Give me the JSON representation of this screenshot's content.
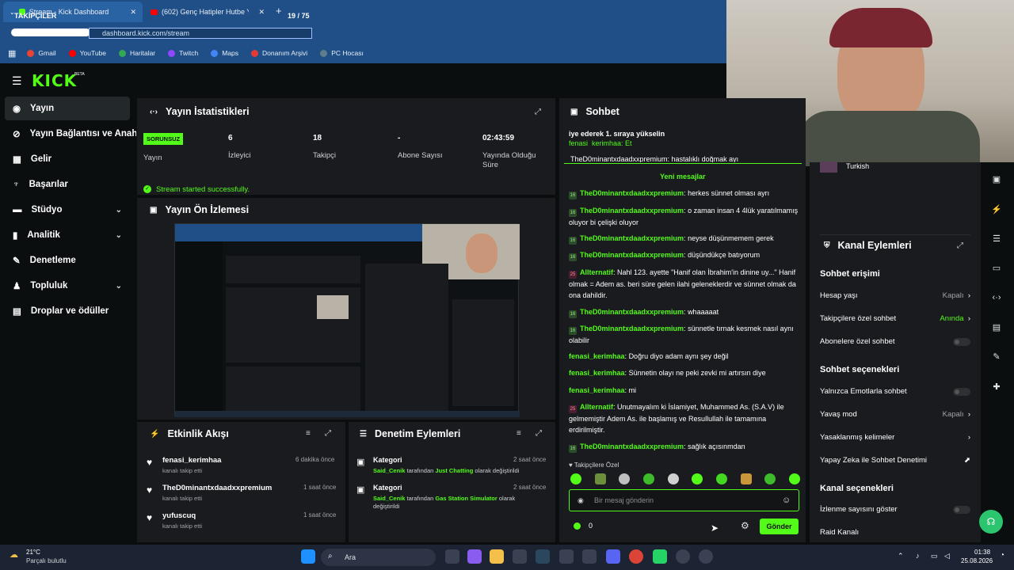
{
  "browser": {
    "tabs": [
      {
        "label": "Stream - Kick Dashboard"
      },
      {
        "label": "(602) Genç Hatipler Hutbe Yarış"
      }
    ],
    "overlay_label": "TAKİPÇİLER",
    "overlay_count": "19 / 75",
    "url": "dashboard.kick.com/stream",
    "new_tab": "+"
  },
  "bookmarks": [
    {
      "label": "Gmail",
      "color": "#ea4335"
    },
    {
      "label": "YouTube",
      "color": "#ff0000"
    },
    {
      "label": "Haritalar",
      "color": "#34a853"
    },
    {
      "label": "Twitch",
      "color": "#9146ff"
    },
    {
      "label": "Maps",
      "color": "#4285f4"
    },
    {
      "label": "Donanım Arşivi",
      "color": "#e53935"
    },
    {
      "label": "PC Hocası",
      "color": "#607d8b"
    }
  ],
  "brand": {
    "logo": "KICK",
    "beta": "BETA"
  },
  "sidebar": {
    "items": [
      {
        "label": "Yayın",
        "icon": "broadcast-icon"
      },
      {
        "label": "Yayın Bağlantısı ve Anahtar",
        "icon": "link-icon"
      },
      {
        "label": "Gelir",
        "icon": "revenue-icon"
      },
      {
        "label": "Başarılar",
        "icon": "trophy-icon"
      },
      {
        "label": "Stüdyo",
        "icon": "studio-icon"
      },
      {
        "label": "Analitik",
        "icon": "analytics-icon"
      },
      {
        "label": "Denetleme",
        "icon": "wrench-icon"
      },
      {
        "label": "Topluluk",
        "icon": "community-icon"
      },
      {
        "label": "Droplar ve ödüller",
        "icon": "drops-icon"
      }
    ]
  },
  "stats": {
    "title": "Yayın İstatistikleri",
    "status_badge": "SORUNSUZ",
    "status_label": "Yayın",
    "viewers": "6",
    "viewers_label": "İzleyici",
    "followers": "18",
    "followers_label": "Takipçi",
    "subs": "-",
    "subs_label": "Abone Sayısı",
    "duration": "02:43:59",
    "duration_label": "Yayında Olduğu Süre",
    "notice": "Stream started successfully."
  },
  "preview": {
    "title": "Yayın Ön İzlemesi"
  },
  "activity": {
    "title": "Etkinlik Akışı",
    "items": [
      {
        "user": "fenasi_kerimhaa",
        "action": "kanalı takip etti",
        "time": "6 dakika önce"
      },
      {
        "user": "TheD0minantxdaadxxpremium",
        "action": "kanalı takip etti",
        "time": "1 saat önce"
      },
      {
        "user": "yufuscuq",
        "action": "kanalı takip etti",
        "time": "1 saat önce"
      }
    ]
  },
  "moderation": {
    "title": "Denetim Eylemleri",
    "items": [
      {
        "head": "Kategori",
        "user": "Said_Cenik",
        "pre": "tarafından",
        "cat": "Just Chatting",
        "post": "olarak değiştirildi",
        "time": "2 saat önce"
      },
      {
        "head": "Kategori",
        "user": "Said_Cenik",
        "pre": "tarafından",
        "cat": "Gas Station Simulator",
        "post": "olarak değiştirildi",
        "time": "2 saat önce"
      }
    ]
  },
  "chat": {
    "title": "Sohbet",
    "pinned": "iye ederek 1. sıraya yükselin",
    "pinned2": "fenasi_kerimhaa: Et",
    "partial": "TheD0minantxdaadxxpremium: hastalıklı doğmak ayı",
    "new_messages": "Yeni mesajlar",
    "messages": [
      {
        "badge": "16",
        "user": "TheD0minantxdaadxxpremium",
        "text": "herkes sünnet olması ayrı"
      },
      {
        "badge": "16",
        "user": "TheD0minantxdaadxxpremium",
        "text": "o zaman insan 4 4lük yaratılmamış oluyor bi çelişki oluyor"
      },
      {
        "badge": "16",
        "user": "TheD0minantxdaadxxpremium",
        "text": "neyse düşünmemem gerek"
      },
      {
        "badge": "16",
        "user": "TheD0minantxdaadxxpremium",
        "text": "düşündükçe batıyorum"
      },
      {
        "badge": "25",
        "user": "Allternatif",
        "text": "Nahl 123. ayette \"Hanif olan İbrahim'in dinine uy...\" Hanif olmak = Adem as. beri süre gelen ilahi geleneklerdir ve sünnet olmak da ona dahildir."
      },
      {
        "badge": "16",
        "user": "TheD0minantxdaadxxpremium",
        "text": "whaaaaat"
      },
      {
        "badge": "16",
        "user": "TheD0minantxdaadxxpremium",
        "text": "sünnetle tırnak kesmek nasıl aynı olabilir"
      },
      {
        "badge": "",
        "user": "fenasi_kerimhaa",
        "text": "Doğru diyo adam aynı şey değil"
      },
      {
        "badge": "",
        "user": "fenasi_kerimhaa",
        "text": "Sünnetin olayı ne peki zevki mi artırsın diye"
      },
      {
        "badge": "",
        "user": "fenasi_kerimhaa",
        "text": "mi"
      },
      {
        "badge": "25",
        "user": "Allternatif",
        "text": "Unutmayalım ki İslamiyet, Muhammed As. (S.A.V) ile gelmemiştir Adem As. ile başlamış ve Resullullah ile tamamına erdirilmiştir."
      },
      {
        "badge": "16",
        "user": "TheD0minantxdaadxxpremium",
        "text": "sağlık açısınmdan"
      }
    ],
    "emote_label": "Takipçilere Özel",
    "input_placeholder": "Bir mesaj gönderin",
    "points": "0",
    "send": "Gönder"
  },
  "channel_actions": {
    "language": "Turkish",
    "title": "Kanal Eylemleri",
    "sections": [
      {
        "head": "Sohbet erişimi",
        "items": [
          {
            "label": "Hesap yaşı",
            "value": "Kapalı",
            "kind": "arrow"
          },
          {
            "label": "Takipçilere özel sohbet",
            "value": "Anında",
            "kind": "arrow-green"
          },
          {
            "label": "Abonelere özel sohbet",
            "value": "",
            "kind": "toggle"
          }
        ]
      },
      {
        "head": "Sohbet seçenekleri",
        "items": [
          {
            "label": "Yalnızca Emotlarla sohbet",
            "value": "",
            "kind": "toggle"
          },
          {
            "label": "Yavaş mod",
            "value": "Kapalı",
            "kind": "arrow"
          },
          {
            "label": "Yasaklanmış kelimeler",
            "value": "",
            "kind": "arrow"
          },
          {
            "label": "Yapay Zeka ile Sohbet Denetimi",
            "value": "",
            "kind": "external"
          }
        ]
      },
      {
        "head": "Kanal seçenekleri",
        "items": [
          {
            "label": "İzlenme sayısını göster",
            "value": "",
            "kind": "toggle"
          },
          {
            "label": "Raid Kanalı",
            "value": "",
            "kind": "none"
          }
        ]
      }
    ]
  },
  "taskbar": {
    "weather_temp": "21°C",
    "weather_desc": "Parçalı bulutlu",
    "search": "Ara",
    "time": "01:38",
    "date": "25.08.2026"
  }
}
